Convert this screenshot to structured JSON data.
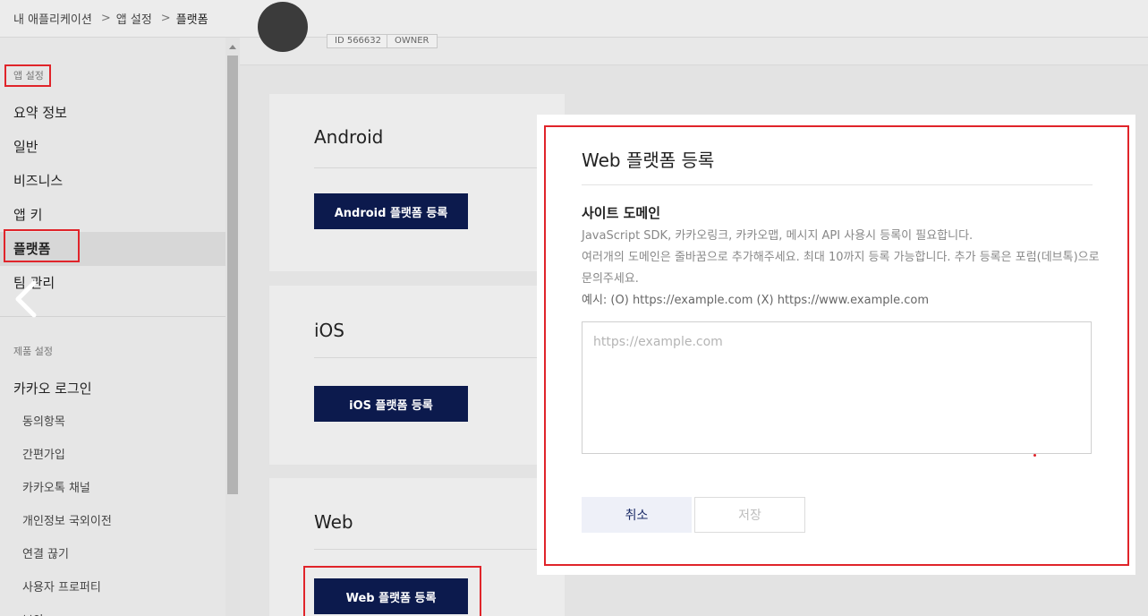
{
  "breadcrumb": {
    "items": [
      "내 애플리케이션",
      "앱 설정",
      "플랫폼"
    ]
  },
  "sidebar": {
    "app_settings_label": "앱 설정",
    "app_items": [
      {
        "label": "요약 정보"
      },
      {
        "label": "일반"
      },
      {
        "label": "비즈니스"
      },
      {
        "label": "앱 키"
      },
      {
        "label": "플랫폼"
      },
      {
        "label": "팀 관리"
      }
    ],
    "product_settings_label": "제품 설정",
    "product_item": "카카오 로그인",
    "sub_items": [
      "동의항목",
      "간편가입",
      "카카오톡 채널",
      "개인정보 국외이전",
      "연결 끊기",
      "사용자 프로퍼티",
      "보안"
    ]
  },
  "header": {
    "id_tag": "ID 566632",
    "role_tag": "OWNER"
  },
  "platforms": {
    "android": {
      "title": "Android",
      "button": "Android 플랫폼 등록"
    },
    "ios": {
      "title": "iOS",
      "button": "iOS 플랫폼 등록"
    },
    "web": {
      "title": "Web",
      "button": "Web 플랫폼 등록"
    }
  },
  "modal": {
    "title": "Web 플랫폼 등록",
    "section_title": "사이트 도메인",
    "desc_line1": "JavaScript SDK, 카카오링크, 카카오맵, 메시지 API 사용시 등록이 필요합니다.",
    "desc_line2": "여러개의 도메인은 줄바꿈으로 추가해주세요. 최대 10까지 등록 가능합니다. 추가 등록은 포럼(데브톡)으로 문의주세요.",
    "desc_example": "예시: (O) https://example.com (X) https://www.example.com",
    "input_value": "",
    "input_placeholder": "https://example.com",
    "cancel_label": "취소",
    "save_label": "저장"
  },
  "colors": {
    "highlight": "#e0242a",
    "primary_button": "#0c1a4d"
  }
}
